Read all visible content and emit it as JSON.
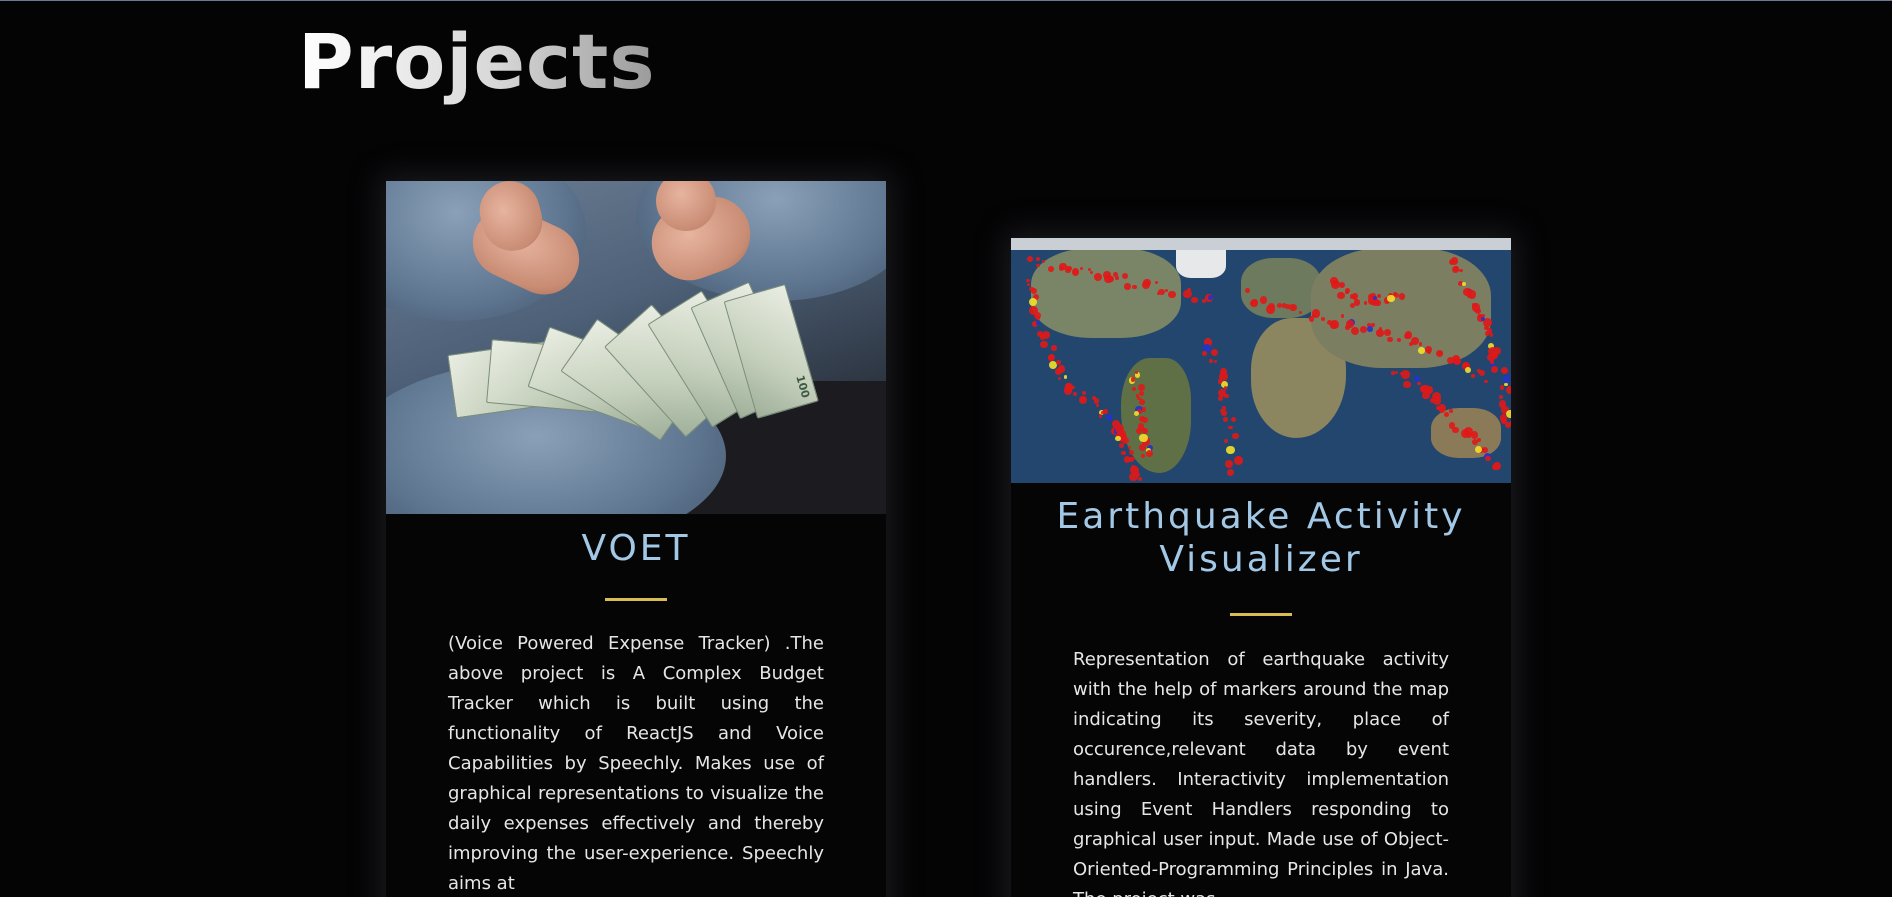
{
  "section": {
    "title": "Projects"
  },
  "projects": [
    {
      "title": "VOET",
      "image": "money-photo",
      "description": "(Voice Powered Expense Tracker) .The above project is A Complex Budget Tracker which is built using the functionality of ReactJS and Voice Capabilities by Speechly. Makes use of graphical representations to visualize the daily expenses effectively and thereby improving the user-experience. Speechly aims at"
    },
    {
      "title": "Earthquake Activity Visualizer",
      "image": "earthquake-world-map",
      "description": "Representation of earthquake activity with the help of markers around the map indicating its severity, place of occurence,relevant data by event handlers. Interactivity implementation using Event Handlers responding to graphical user input. Made use of Object-Oriented-Programming Principles in Java. The project was"
    }
  ],
  "colors": {
    "background": "#040405",
    "card_title": "#a2c8e6",
    "divider": "#d8bd52",
    "text": "#e6e6e6"
  }
}
